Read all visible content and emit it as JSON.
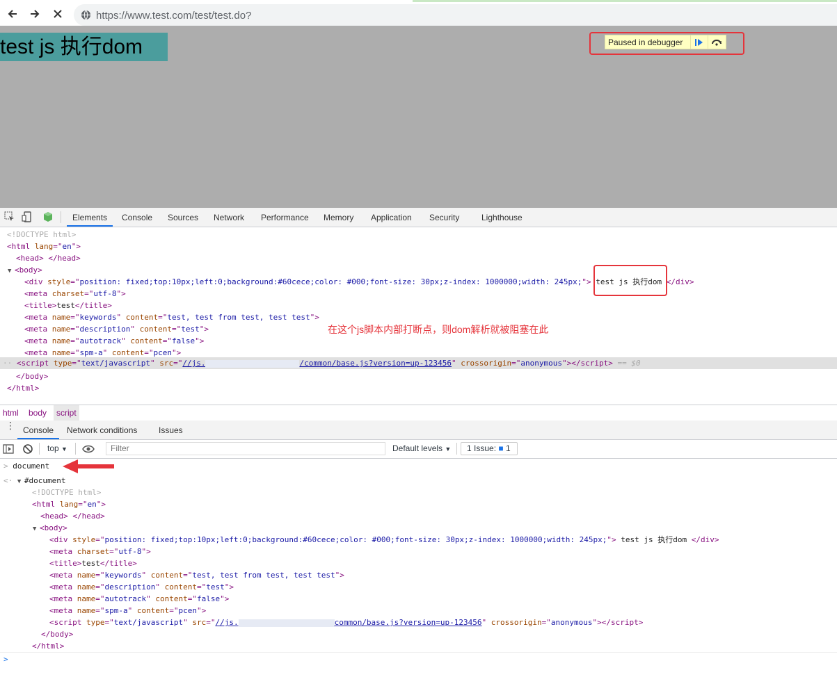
{
  "browser": {
    "url": "https://www.test.com/test/test.do?"
  },
  "page": {
    "div_text": "test js 执行dom",
    "paused_label": "Paused in debugger"
  },
  "devtools": {
    "tabs": [
      "Elements",
      "Console",
      "Sources",
      "Network",
      "Performance",
      "Memory",
      "Application",
      "Security",
      "Lighthouse"
    ],
    "active_tab": "Elements",
    "annotation": "在这个js脚本内部打断点，则dom解析就被阻塞在此",
    "breadcrumbs": [
      "html",
      "body",
      "script"
    ],
    "drawer_tabs": [
      "Console",
      "Network conditions",
      "Issues"
    ],
    "console_toolbar": {
      "context": "top",
      "filter_placeholder": "Filter",
      "levels": "Default levels",
      "issues": "1 Issue:",
      "issues_count": "1"
    },
    "elements": {
      "doctype": "<!DOCTYPE html>",
      "html_open": "<html",
      "lang_attr": "lang",
      "lang_val": "en",
      "head": "<head>",
      "head_close": "</head>",
      "body": "<body>",
      "body_close": "</body>",
      "html_close": "</html>",
      "div_style": "position: fixed;top:10px;left:0;background:#60cece;color: #000;font-size: 30px;z-index: 1000000;width: 245px;",
      "div_text": "test js 执行dom",
      "meta_charset": "utf-8",
      "title_text": "test",
      "keywords": "test, test from test, test test",
      "description": "test",
      "autotrack": "false",
      "spm_a": "pcen",
      "script_type": "text/javascript",
      "script_src_start": "//js.",
      "script_src_end": "/common/base.js?version=up-123456",
      "script_src_end2": "common/base.js?version=up-123456",
      "crossorigin": "anonymous",
      "selected_marker": "== $0"
    },
    "console": {
      "input": "document",
      "result": "#document"
    }
  }
}
